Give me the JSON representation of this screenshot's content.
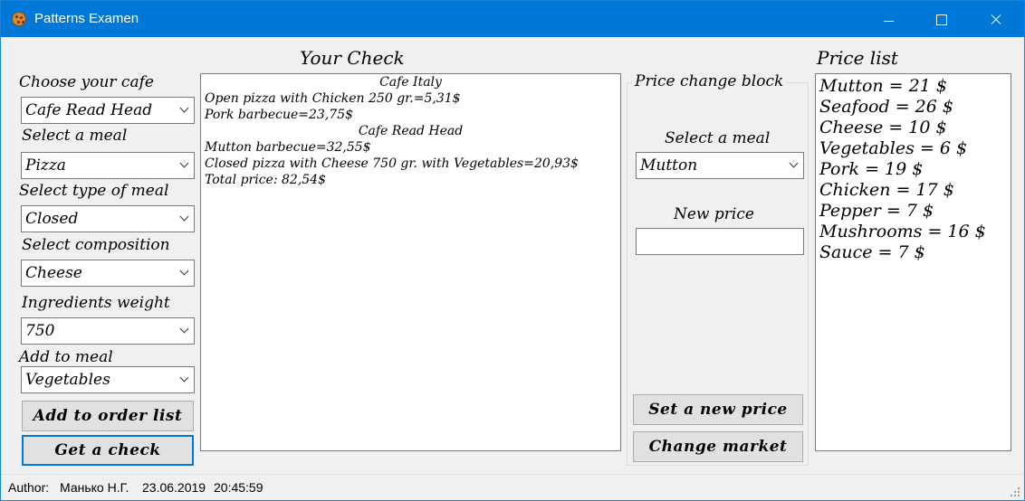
{
  "window": {
    "title": "Patterns Examen"
  },
  "left_panel": {
    "cafe_label": "Choose your cafe",
    "cafe_value": "Cafe Read Head",
    "meal_label": "Select a meal",
    "meal_value": "Pizza",
    "type_label": "Select type of meal",
    "type_value": "Closed",
    "composition_label": "Select composition",
    "composition_value": "Cheese",
    "weight_label": "Ingredients weight",
    "weight_value": "750",
    "add_label": "Add to meal",
    "add_value": "Vegetables",
    "add_button": "Add to order list",
    "check_button": "Get a check"
  },
  "check": {
    "title": "Your Check",
    "lines": [
      "Cafe Italy",
      "Open pizza with Chicken 250 gr.=5,31$",
      "Pork barbecue=23,75$",
      "Cafe Read Head",
      "Mutton barbecue=32,55$",
      "Closed pizza with Cheese 750 gr. with Vegetables=20,93$",
      "Total price: 82,54$"
    ]
  },
  "price_change": {
    "group_title": "Price change block",
    "meal_label": "Select a meal",
    "meal_value": "Mutton",
    "new_price_label": "New price",
    "new_price_value": "",
    "set_button": "Set a new price",
    "change_button": "Change market"
  },
  "price_list": {
    "title": "Price list",
    "items": [
      "Mutton = 21 $",
      "Seafood = 26 $",
      "Cheese = 10 $",
      "Vegetables = 6 $",
      "Pork = 19 $",
      "Chicken = 17 $",
      "Pepper = 7 $",
      "Mushrooms = 16 $",
      "Sauce = 7 $"
    ]
  },
  "status": {
    "author_label": "Author:",
    "author_name": "Манько Н.Г.",
    "date": "23.06.2019",
    "time": "20:45:59"
  }
}
